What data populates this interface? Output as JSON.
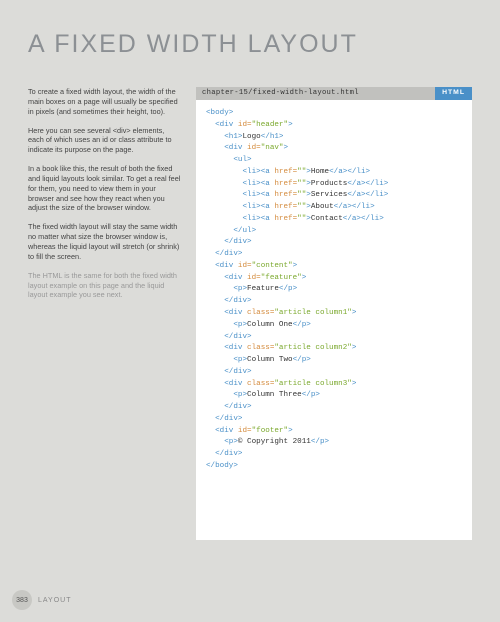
{
  "title": "A FIXED WIDTH LAYOUT",
  "paragraphs": [
    "To create a fixed width layout, the width of the main boxes on a page will usually be specified in pixels (and sometimes their height, too).",
    "Here you can see several <div> elements, each of which uses an id or class attribute to indicate its purpose on the page.",
    "In a book like this, the result of both the fixed and liquid layouts look similar. To get a real feel for them, you need to view them in your browser and see how they react when you adjust the size of the browser window.",
    "The fixed width layout will stay the same width no matter what size the browser window is, whereas the liquid layout will stretch (or shrink) to fill the screen.",
    "The HTML is the same for both the fixed width layout example on this page and the liquid layout example you see next."
  ],
  "filename": "chapter-15/fixed-width-layout.html",
  "badge": "HTML",
  "code": {
    "nav_items": [
      "Home",
      "Products",
      "Services",
      "About",
      "Contact"
    ],
    "h1_text": "Logo",
    "feature_text": "Feature",
    "columns": [
      "Column One",
      "Column Two",
      "Column Three"
    ],
    "copyright": "&copy; Copyright 2011"
  },
  "page_number": "383",
  "section_label": "LAYOUT"
}
